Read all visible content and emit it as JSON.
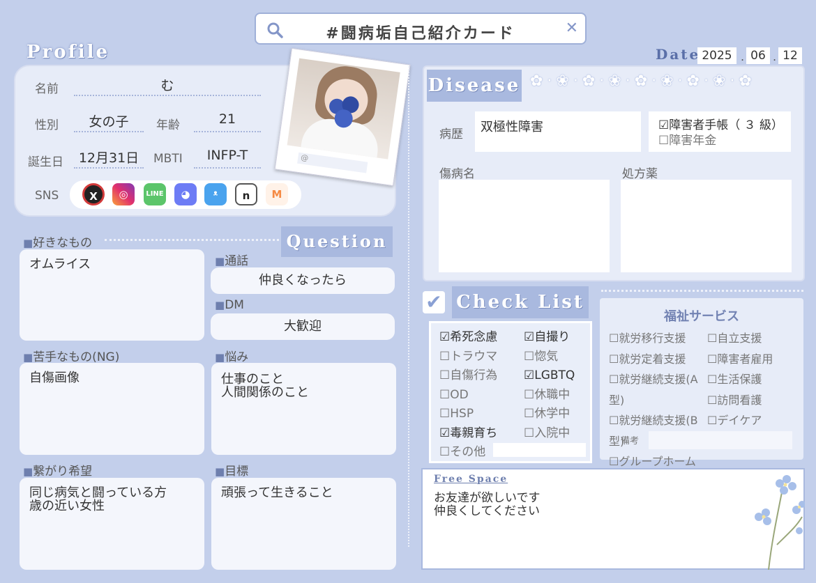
{
  "search": {
    "text": "#闘病垢自己紹介カード"
  },
  "profile_title": "Profile",
  "date": {
    "label": "Date",
    "year": "2025",
    "month": "06",
    "day": "12"
  },
  "profile": {
    "name_label": "名前",
    "name": "む",
    "gender_label": "性別",
    "gender": "女の子",
    "age_label": "年齢",
    "age": "21",
    "birthday_label": "誕生日",
    "birthday": "12月31日",
    "mbti_label": "MBTI",
    "mbti": "INFP-T",
    "sns_label": "SNS",
    "photo_handle": "@"
  },
  "sns_icons": [
    "x-icon",
    "instagram-icon",
    "line-icon",
    "discord-icon",
    "bluesky-icon",
    "note-icon",
    "misskey-icon"
  ],
  "question_title": "Question",
  "likes": {
    "label": "好きなもの",
    "text": "オムライス"
  },
  "call": {
    "label": "通話",
    "text": "仲良くなったら"
  },
  "dm": {
    "label": "DM",
    "text": "大歓迎"
  },
  "dislikes": {
    "label": "苦手なもの(NG)",
    "text": "自傷画像"
  },
  "worries": {
    "label": "悩み",
    "text": "仕事のこと\n人間関係のこと"
  },
  "connect": {
    "label": "繋がり希望",
    "text": "同じ病気と闘っている方\n歳の近い女性"
  },
  "goal": {
    "label": "目標",
    "text": "頑張って生きること"
  },
  "disease": {
    "title": "Disease",
    "history_label": "病歴",
    "history": "双極性障害",
    "handbook": "☑障害者手帳（ ３ 級）",
    "pension": "☐障害年金",
    "injury_label": "傷病名",
    "prescription_label": "処方薬"
  },
  "checklist": {
    "title": "Check List",
    "items": [
      "☑希死念慮",
      "☑自撮り",
      "☐トラウマ",
      "☐惚気",
      "☐自傷行為",
      "☑LGBTQ",
      "☐OD",
      "☐休職中",
      "☐HSP",
      "☐休学中",
      "☑毒親育ち",
      "☐入院中",
      "☐その他"
    ]
  },
  "welfare": {
    "title": "福祉サービス",
    "items": [
      "☐就労移行支援",
      "☐自立支援",
      "☐就労定着支援",
      "☐障害者雇用",
      "☐就労継続支援(A型)",
      "☐生活保護",
      "☐就労継続支援(B型)",
      "☐訪問看護",
      "☐グループホーム",
      "☐デイケア"
    ],
    "notes_label": "備考"
  },
  "free_space": {
    "title": "Free Space",
    "text": "お友達が欲しいです\n仲良くしてください"
  },
  "colors": {
    "background": "#c3cfeb",
    "panel": "#e7ecf8",
    "accent": "#a9b9df",
    "text": "#555555"
  }
}
